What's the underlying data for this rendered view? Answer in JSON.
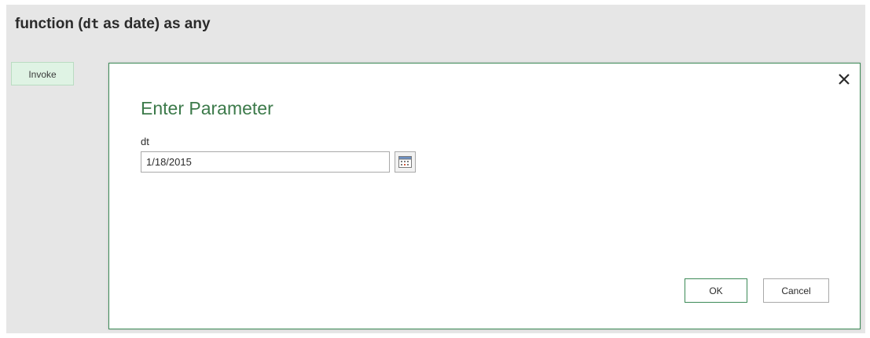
{
  "header": {
    "fn_prefix": "function (",
    "fn_param": "dt",
    "fn_suffix": " as date) as any"
  },
  "invoke_button": {
    "label": "Invoke"
  },
  "dialog": {
    "title": "Enter Parameter",
    "close_icon": "close-icon",
    "parameter": {
      "label": "dt",
      "value": "1/18/2015",
      "picker_icon": "calendar-icon"
    },
    "ok_label": "OK",
    "cancel_label": "Cancel"
  },
  "colors": {
    "accent_green": "#3c8a57",
    "title_green": "#3c7a4a",
    "invoke_bg": "#dff3e4",
    "canvas_bg": "#e6e6e6"
  }
}
